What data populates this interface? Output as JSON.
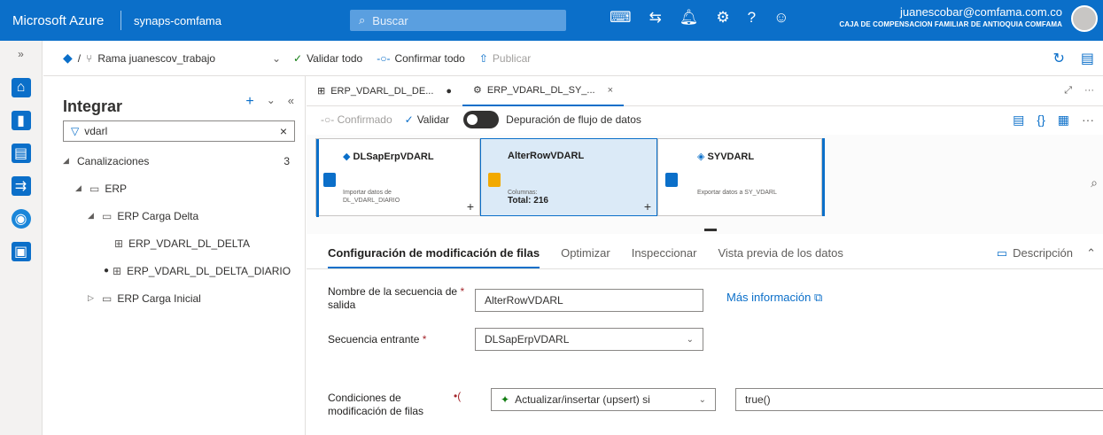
{
  "header": {
    "brand": "Microsoft Azure",
    "workspace": "synaps-comfama",
    "search_placeholder": "Buscar",
    "user_email": "juanescobar@comfama.com.co",
    "user_org": "CAJA DE COMPENSACION FAMILIAR DE ANTIOQUIA COMFAMA"
  },
  "rail": {
    "collapse_label": "»"
  },
  "git": {
    "branch": "Rama juanescov_trabajo",
    "validate_all": "Validar todo",
    "commit_all": "Confirmar todo",
    "publish": "Publicar"
  },
  "panel": {
    "title": "Integrar",
    "filter_value": "vdarl",
    "tree": {
      "pipelines_label": "Canalizaciones",
      "pipelines_count": "3",
      "erp": "ERP",
      "carga_delta": "ERP Carga Delta",
      "item1": "ERP_VDARL_DL_DELTA",
      "item2": "ERP_VDARL_DL_DELTA_DIARIO",
      "carga_inicial": "ERP Carga Inicial"
    }
  },
  "tabs": [
    {
      "label": "ERP_VDARL_DL_DE..."
    },
    {
      "label": "ERP_VDARL_DL_SY_..."
    }
  ],
  "dataflow_toolbar": {
    "confirmed": "Confirmado",
    "validate": "Validar",
    "debug": "Depuración de flujo de datos"
  },
  "nodes": {
    "source": {
      "title": "DLSapErpVDARL",
      "desc1": "Importar datos de",
      "desc2": "DL_VDARL_DIARIO"
    },
    "alter": {
      "title": "AlterRowVDARL",
      "columns_label": "Columnas:",
      "total": "Total: 216"
    },
    "sink": {
      "title": "SYVDARL",
      "desc": "Exportar datos a SY_VDARL"
    }
  },
  "props_tabs": {
    "config": "Configuración de modificación de filas",
    "optimize": "Optimizar",
    "inspect": "Inspeccionar",
    "preview": "Vista previa de los datos",
    "description": "Descripción"
  },
  "form": {
    "output_label_1": "Nombre de la secuencia de",
    "output_label_2": "salida",
    "output_value": "AlterRowVDARL",
    "more_info": "Más información",
    "incoming_label": "Secuencia entrante",
    "incoming_value": "DLSapErpVDARL",
    "conditions_label_1": "Condiciones de",
    "conditions_label_2": "modificación de filas",
    "condition_type": "Actualizar/insertar (upsert) si",
    "condition_expr": "true()"
  },
  "colors": {
    "accent": "#0b6fc9",
    "alter_node_bg": "#dbeaf7",
    "upsert_icon": "#107c10"
  }
}
